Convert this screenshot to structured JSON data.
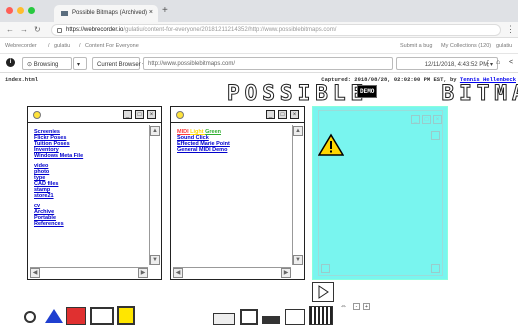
{
  "browser": {
    "tab_title": "Possible Bitmaps (Archived)",
    "tab_close": "×",
    "new_tab": "+",
    "url_host": "https://webrecorder.io",
    "url_path": "/gulatiu/content-for-everyone/20181211214352/http://www.possiblebitmaps.com/",
    "traffic_colors": [
      "#ff5f57",
      "#ffbd2e",
      "#28c940"
    ]
  },
  "webrecorder": {
    "breadcrumb": [
      "Webrecorder",
      "gulatiu",
      "Content For Everyone"
    ],
    "submit_bug": "Submit a bug",
    "my_collections": "My Collections (120)",
    "user": "gulatiu",
    "mode_label": "Browsing",
    "browser_select": "Current Browser",
    "archived_url": "http://www.possiblebitmaps.com/",
    "timestamp": "12/11/2018, 4:43:52 PM"
  },
  "page": {
    "index_label": "index.html",
    "captured_prefix": "Captured: 2018/08/28, 02:02:00 PM EST, by ",
    "captured_author": "Tennis Hellenbeck",
    "logo_left": "POSSIBLE",
    "demo_badge": "DEMO",
    "logo_right": "BITMAPS"
  },
  "window1": {
    "links": [
      "Screenies",
      "Flickr Poses",
      "Tuition Poses",
      "Inventory",
      "Windows Meta File",
      "video",
      "photo",
      "type",
      "CAD files",
      "stamp",
      "store21",
      "cv",
      "Archive",
      "Portable",
      "References"
    ]
  },
  "window2": {
    "links": [
      {
        "text": "MIDI ",
        "color": "#ff3b3b"
      },
      {
        "text": "Light ",
        "color": "#ffd800"
      },
      {
        "text": "Green",
        "color": "#2fae2f"
      }
    ],
    "links2": [
      "Sound Click",
      "Effected Marie Point",
      "General MIDI Demo"
    ]
  },
  "colors": {
    "cyan": "#79f5ef",
    "link": "#0000cc"
  },
  "bottom": {
    "icons": [
      "arrow-left",
      "minus",
      "plus"
    ]
  }
}
